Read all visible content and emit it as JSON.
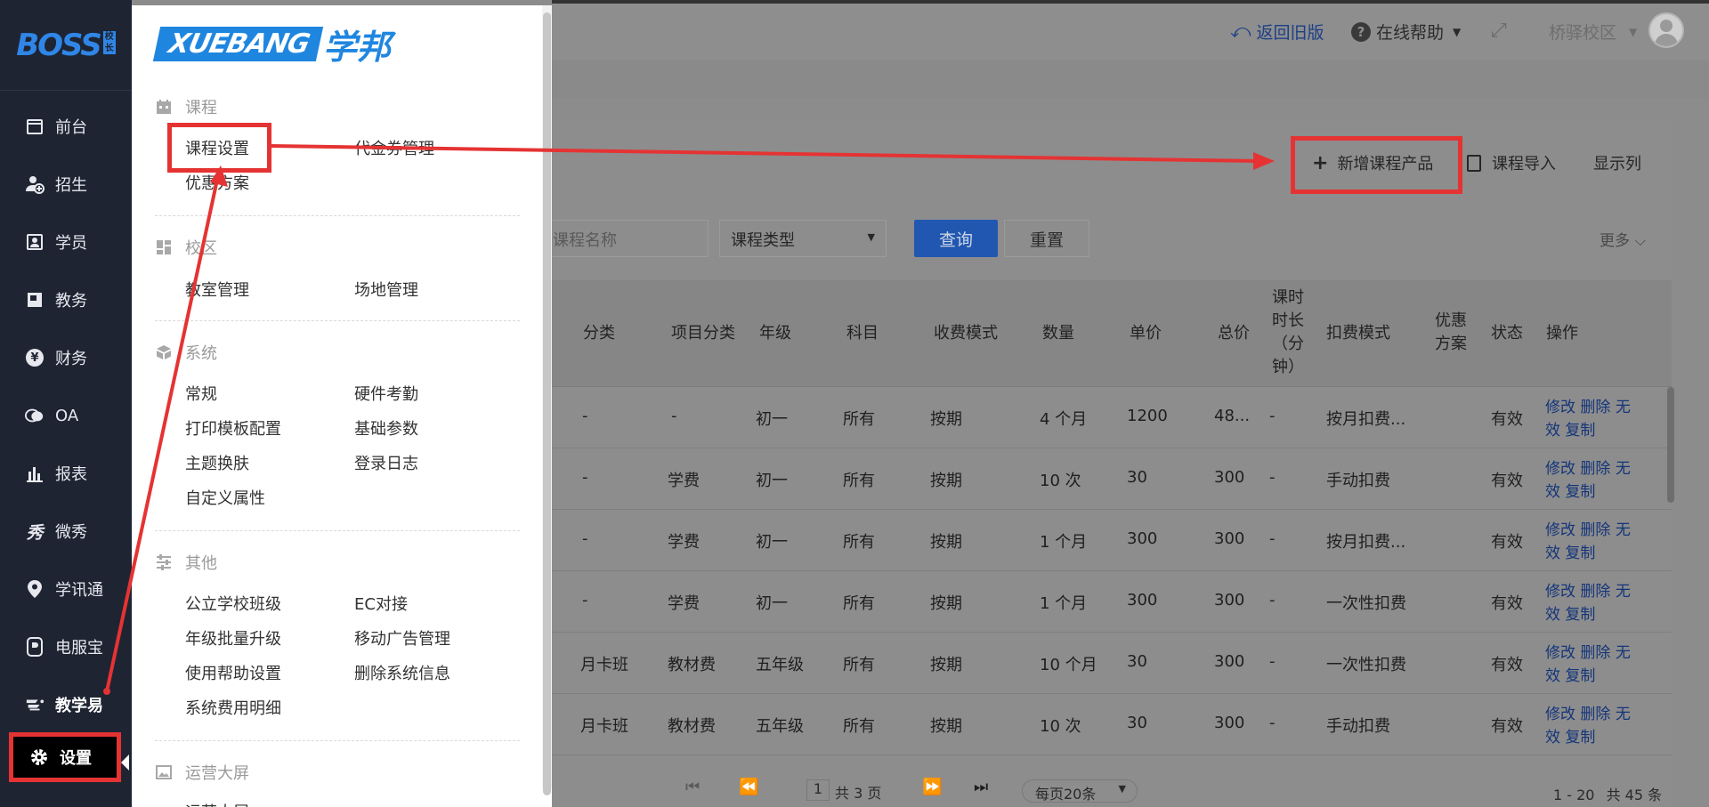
{
  "colors": {
    "sidebar_bg": "#1e2432",
    "accent_blue": "#1f86e0",
    "highlight_red": "#e53333",
    "link_blue": "#14357a"
  },
  "sidebar": {
    "logo_text": "BOSS",
    "logo_badge": "校长",
    "items": [
      {
        "label": "前台",
        "icon": "calendar-icon"
      },
      {
        "label": "招生",
        "icon": "add-user-icon"
      },
      {
        "label": "学员",
        "icon": "id-card-icon"
      },
      {
        "label": "教务",
        "icon": "book-icon"
      },
      {
        "label": "财务",
        "icon": "yen-icon"
      },
      {
        "label": "OA",
        "icon": "chat-icon"
      },
      {
        "label": "报表",
        "icon": "bar-chart-icon"
      },
      {
        "label": "微秀",
        "icon": "xiu-icon"
      },
      {
        "label": "学讯通",
        "icon": "location-pin-icon"
      },
      {
        "label": "电服宝",
        "icon": "phone-icon"
      },
      {
        "label": "教学易",
        "icon": "teach-icon"
      },
      {
        "label": "设置",
        "icon": "gear-icon"
      }
    ]
  },
  "header": {
    "back_old": "返回旧版",
    "help": "在线帮助",
    "campus": "桥驿校区"
  },
  "menu": {
    "brand_en": "XUEBANG",
    "brand_cn": "学邦",
    "sections": [
      {
        "title": "课程",
        "icon": "calendar-icon",
        "items": [
          "课程设置",
          "代金券管理",
          "优惠方案"
        ]
      },
      {
        "title": "校区",
        "icon": "grid-icon",
        "items": [
          "教室管理",
          "场地管理"
        ]
      },
      {
        "title": "系统",
        "icon": "cube-icon",
        "items": [
          "常规",
          "硬件考勤",
          "打印模板配置",
          "基础参数",
          "主题换肤",
          "登录日志",
          "自定义属性"
        ]
      },
      {
        "title": "其他",
        "icon": "sliders-icon",
        "items": [
          "公立学校班级",
          "EC对接",
          "年级批量升级",
          "移动广告管理",
          "使用帮助设置",
          "删除系统信息",
          "系统费用明细"
        ]
      },
      {
        "title": "运营大屏",
        "icon": "image-icon",
        "items": [
          "运营大屏"
        ]
      }
    ]
  },
  "toolbar": {
    "add_course": "新增课程产品",
    "import_course": "课程导入",
    "show_columns": "显示列"
  },
  "filters": {
    "course_name_placeholder": "课程名称",
    "course_type": "课程类型",
    "query": "查询",
    "reset": "重置",
    "more": "更多"
  },
  "table": {
    "headers": {
      "category": "分类",
      "project_category": "项目分类",
      "grade": "年级",
      "subject": "科目",
      "fee_mode": "收费模式",
      "quantity": "数量",
      "unit_price": "单价",
      "total_price": "总价",
      "duration": "课时时长（分钟）",
      "deduct_mode": "扣费模式",
      "discount": "优惠方案",
      "status": "状态",
      "actions": "操作"
    },
    "rows": [
      {
        "category": "-",
        "project": "-",
        "grade": "初一",
        "subject": "所有",
        "fee_mode": "按期",
        "qty": "4 个月",
        "unit": "1200",
        "total": "48...",
        "duration": "-",
        "deduct": "按月扣费...",
        "status": "有效"
      },
      {
        "category": "-",
        "project": "学费",
        "grade": "初一",
        "subject": "所有",
        "fee_mode": "按期",
        "qty": "10 次",
        "unit": "30",
        "total": "300",
        "duration": "-",
        "deduct": "手动扣费",
        "status": "有效"
      },
      {
        "category": "-",
        "project": "学费",
        "grade": "初一",
        "subject": "所有",
        "fee_mode": "按期",
        "qty": "1 个月",
        "unit": "300",
        "total": "300",
        "duration": "-",
        "deduct": "按月扣费...",
        "status": "有效"
      },
      {
        "category": "-",
        "project": "学费",
        "grade": "初一",
        "subject": "所有",
        "fee_mode": "按期",
        "qty": "1 个月",
        "unit": "300",
        "total": "300",
        "duration": "-",
        "deduct": "一次性扣费",
        "status": "有效"
      },
      {
        "category": "月卡班",
        "project": "教材费",
        "grade": "五年级",
        "subject": "所有",
        "fee_mode": "按期",
        "qty": "10 个月",
        "unit": "30",
        "total": "300",
        "duration": "-",
        "deduct": "一次性扣费",
        "status": "有效"
      },
      {
        "category": "月卡班",
        "project": "教材费",
        "grade": "五年级",
        "subject": "所有",
        "fee_mode": "按期",
        "qty": "10 次",
        "unit": "30",
        "total": "300",
        "duration": "-",
        "deduct": "手动扣费",
        "status": "有效"
      }
    ],
    "ops": {
      "edit": "修改",
      "delete": "删除",
      "disable": "无效",
      "copy": "复制"
    }
  },
  "pagination": {
    "current_page": "1",
    "total_pages": "共 3 页",
    "per_page": "每页20条",
    "range": "1 - 20",
    "total": "共 45 条"
  }
}
